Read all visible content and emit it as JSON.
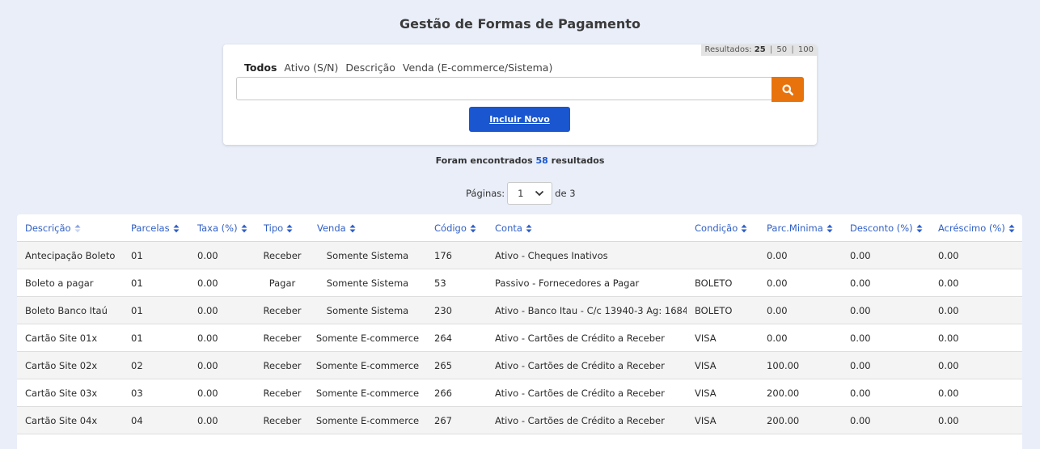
{
  "header": {
    "title": "Gestão de Formas de Pagamento"
  },
  "results_per_page": {
    "label": "Resultados:",
    "options": [
      "25",
      "50",
      "100"
    ],
    "selected": "25"
  },
  "filters": {
    "tabs": [
      "Todos",
      "Ativo (S/N)",
      "Descrição",
      "Venda (E-commerce/Sistema)"
    ],
    "active": "Todos"
  },
  "search": {
    "value": "",
    "placeholder": ""
  },
  "buttons": {
    "new_label": "Incluir Novo"
  },
  "found": {
    "prefix": "Foram encontrados",
    "count": "58",
    "suffix": "resultados"
  },
  "pagination": {
    "label": "Páginas:",
    "current": "1",
    "of_label": "de 3"
  },
  "colors": {
    "accent_blue": "#1a56cf",
    "search_orange": "#e8730c",
    "header_link": "#2f5fc4",
    "background": "#e9eef9"
  },
  "table": {
    "columns": [
      "Descrição",
      "Parcelas",
      "Taxa (%)",
      "Tipo",
      "Venda",
      "Código",
      "Conta",
      "Condição",
      "Parc.Minima",
      "Desconto (%)",
      "Acréscimo (%)"
    ],
    "rows": [
      [
        "Antecipação Boleto",
        "01",
        "0.00",
        "Receber",
        "Somente Sistema",
        "176",
        "Ativo - Cheques Inativos",
        "",
        "0.00",
        "0.00",
        "0.00"
      ],
      [
        "Boleto a pagar",
        "01",
        "0.00",
        "Pagar",
        "Somente Sistema",
        "53",
        "Passivo - Fornecedores a Pagar",
        "BOLETO",
        "0.00",
        "0.00",
        "0.00"
      ],
      [
        "Boleto Banco Itaú",
        "01",
        "0.00",
        "Receber",
        "Somente Sistema",
        "230",
        "Ativo - Banco Itau - C/c 13940-3 Ag: 1684",
        "BOLETO",
        "0.00",
        "0.00",
        "0.00"
      ],
      [
        "Cartão Site 01x",
        "01",
        "0.00",
        "Receber",
        "Somente E-commerce",
        "264",
        "Ativo - Cartões de Crédito a Receber",
        "VISA",
        "0.00",
        "0.00",
        "0.00"
      ],
      [
        "Cartão Site 02x",
        "02",
        "0.00",
        "Receber",
        "Somente E-commerce",
        "265",
        "Ativo - Cartões de Crédito a Receber",
        "VISA",
        "100.00",
        "0.00",
        "0.00"
      ],
      [
        "Cartão Site 03x",
        "03",
        "0.00",
        "Receber",
        "Somente E-commerce",
        "266",
        "Ativo - Cartões de Crédito a Receber",
        "VISA",
        "200.00",
        "0.00",
        "0.00"
      ],
      [
        "Cartão Site 04x",
        "04",
        "0.00",
        "Receber",
        "Somente E-commerce",
        "267",
        "Ativo - Cartões de Crédito a Receber",
        "VISA",
        "200.00",
        "0.00",
        "0.00"
      ],
      [
        "",
        "",
        "",
        "",
        "",
        "",
        "",
        "",
        "",
        "",
        ""
      ]
    ]
  }
}
